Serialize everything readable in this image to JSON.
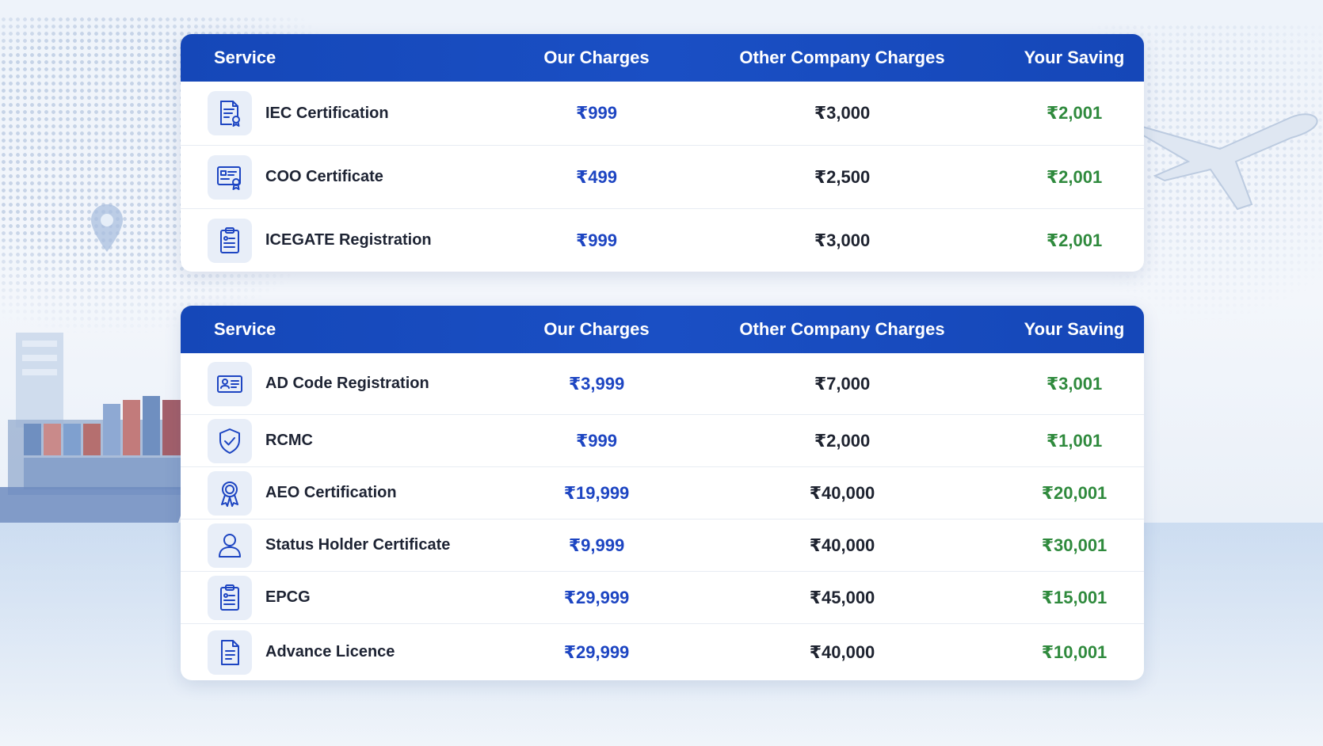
{
  "table1": {
    "headers": {
      "service": "Service",
      "ours": "Our Charges",
      "other": "Other Company Charges",
      "saving": "Your Saving"
    },
    "rows": [
      {
        "icon": "certificate-document-icon",
        "service": "IEC Certification",
        "ours": "₹999",
        "other": "₹3,000",
        "saving": "₹2,001"
      },
      {
        "icon": "certificate-badge-icon",
        "service": "COO Certificate",
        "ours": "₹499",
        "other": "₹2,500",
        "saving": "₹2,001"
      },
      {
        "icon": "clipboard-icon",
        "service": "ICEGATE Registration",
        "ours": "₹999",
        "other": "₹3,000",
        "saving": "₹2,001"
      }
    ]
  },
  "table2": {
    "headers": {
      "service": "Service",
      "ours": "Our Charges",
      "other": "Other Company Charges",
      "saving": "Your Saving"
    },
    "rows": [
      {
        "icon": "id-card-icon",
        "service": "AD Code Registration",
        "ours": "₹3,999",
        "other": "₹7,000",
        "saving": "₹3,001"
      },
      {
        "icon": "shield-check-icon",
        "service": "RCMC",
        "ours": "₹999",
        "other": "₹2,000",
        "saving": "₹1,001"
      },
      {
        "icon": "award-ribbon-icon",
        "service": "AEO Certification",
        "ours": "₹19,999",
        "other": "₹40,000",
        "saving": "₹20,001"
      },
      {
        "icon": "user-icon",
        "service": "Status Holder Certificate",
        "ours": "₹9,999",
        "other": "₹40,000",
        "saving": "₹30,001"
      },
      {
        "icon": "clipboard-icon",
        "service": "EPCG",
        "ours": "₹29,999",
        "other": "₹45,000",
        "saving": "₹15,001"
      },
      {
        "icon": "document-icon",
        "service": "Advance Licence",
        "ours": "₹29,999",
        "other": "₹40,000",
        "saving": "₹10,001"
      }
    ]
  },
  "colors": {
    "header_bg": "#1a4fc4",
    "our_charges": "#1d45c2",
    "other_charges": "#1e2330",
    "saving": "#2f8a3d",
    "icon_bg": "#e8eef8",
    "icon_stroke": "#1d45c2"
  }
}
